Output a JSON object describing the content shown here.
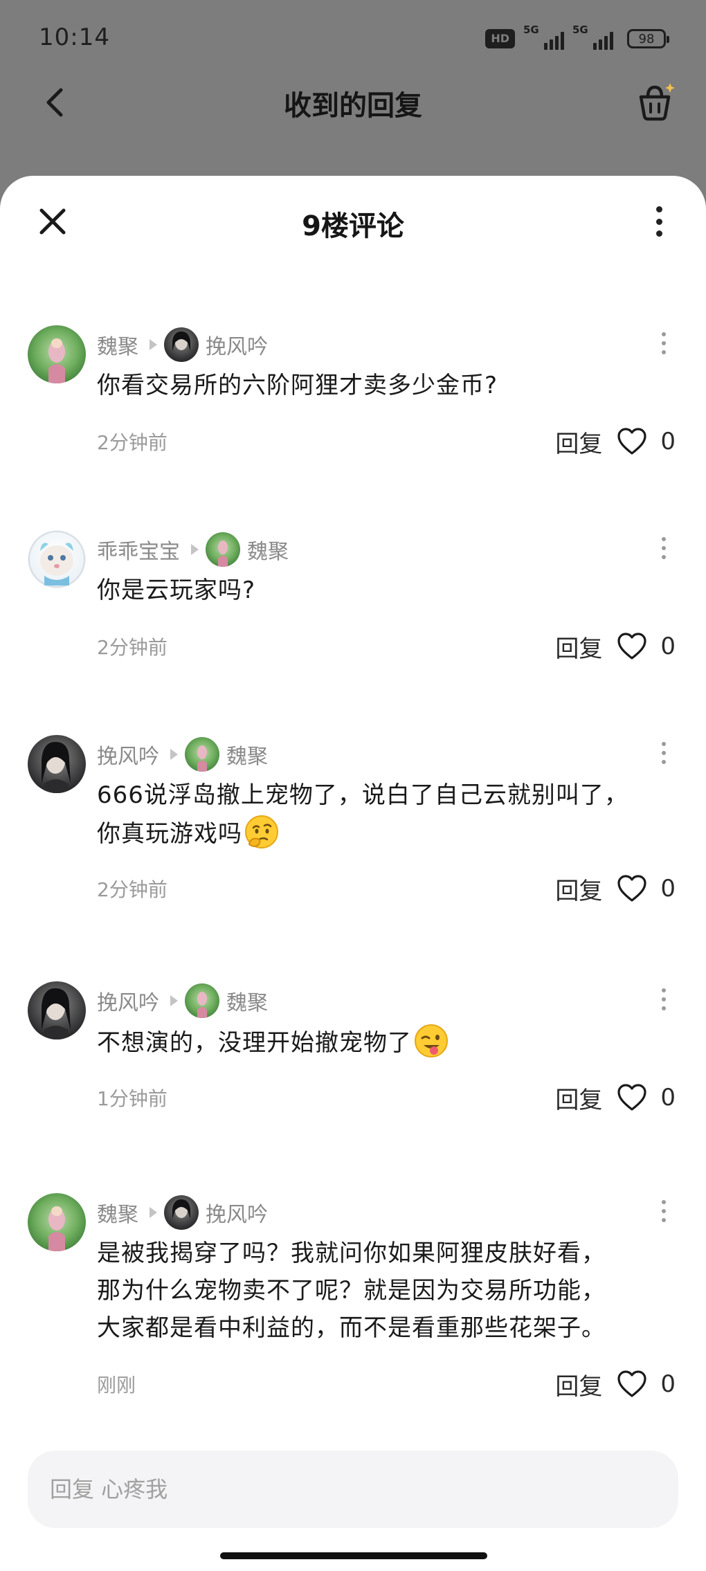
{
  "status_bar": {
    "time": "10:14",
    "hd_label": "HD",
    "network_1": "5G",
    "network_2": "5G",
    "battery": "98"
  },
  "page": {
    "title": "收到的回复"
  },
  "sheet": {
    "title": "9楼评论"
  },
  "comments": [
    {
      "author": "魏聚",
      "reply_to": "挽风吟",
      "lines": [
        "你看交易所的六阶阿狸才卖多少金币?"
      ],
      "time": "2分钟前",
      "reply_label": "回复",
      "likes": "0"
    },
    {
      "author": "乖乖宝宝",
      "reply_to": "魏聚",
      "lines": [
        "你是云玩家吗?"
      ],
      "time": "2分钟前",
      "reply_label": "回复",
      "likes": "0"
    },
    {
      "author": "挽风吟",
      "reply_to": "魏聚",
      "lines": [
        "666说浮岛撤上宠物了，说白了自己云就别叫了，",
        "你真玩游戏吗"
      ],
      "emoji": "thinking-face",
      "time": "2分钟前",
      "reply_label": "回复",
      "likes": "0"
    },
    {
      "author": "挽风吟",
      "reply_to": "魏聚",
      "lines": [
        "不想演的，没理开始撤宠物了"
      ],
      "emoji": "winking-tongue-face",
      "time": "1分钟前",
      "reply_label": "回复",
      "likes": "0"
    },
    {
      "author": "魏聚",
      "reply_to": "挽风吟",
      "lines": [
        "是被我揭穿了吗？我就问你如果阿狸皮肤好看，",
        "那为什么宠物卖不了呢？就是因为交易所功能，",
        "大家都是看中利益的，而不是看重那些花架子。"
      ],
      "time": "刚刚",
      "reply_label": "回复",
      "likes": "0"
    }
  ],
  "input": {
    "placeholder": "回复 心疼我"
  },
  "colors": {
    "dim_overlay": "#7d7d7d",
    "sheet_bg": "#ffffff",
    "name_text": "#8a8a8a",
    "body_text": "#1a1a1a",
    "basket_sparkle": "#f2c14e"
  }
}
